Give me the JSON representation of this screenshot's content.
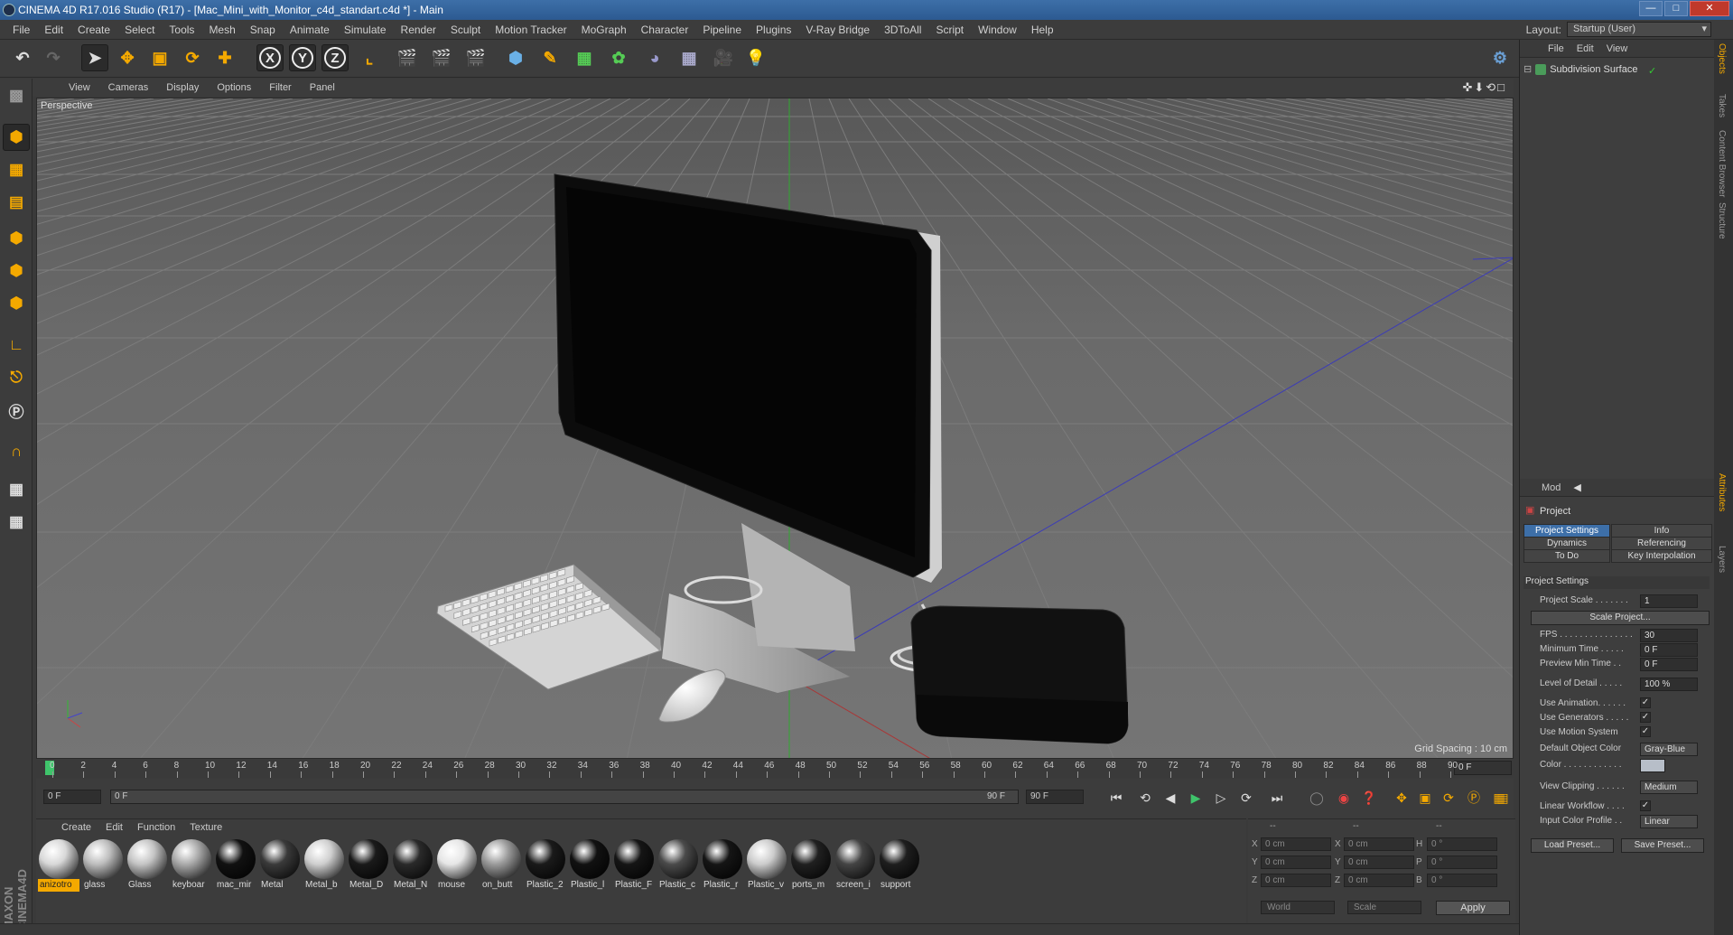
{
  "window": {
    "title": "CINEMA 4D R17.016 Studio (R17) - [Mac_Mini_with_Monitor_c4d_standart.c4d *] - Main",
    "min": "—",
    "max": "□",
    "close": "✕"
  },
  "menu": [
    "File",
    "Edit",
    "Create",
    "Select",
    "Tools",
    "Mesh",
    "Snap",
    "Animate",
    "Simulate",
    "Render",
    "Sculpt",
    "Motion Tracker",
    "MoGraph",
    "Character",
    "Pipeline",
    "Plugins",
    "V-Ray Bridge",
    "3DToAll",
    "Script",
    "Window",
    "Help"
  ],
  "layout": {
    "label": "Layout:",
    "value": "Startup (User)"
  },
  "toolbar": {
    "axis_x": "X",
    "axis_y": "Y",
    "axis_z": "Z"
  },
  "viewport": {
    "menu": [
      "View",
      "Cameras",
      "Display",
      "Options",
      "Filter",
      "Panel"
    ],
    "label": "Perspective",
    "grid_spacing": "Grid Spacing : 10 cm",
    "nav_icons": "✜⬇⟲□"
  },
  "timeline": {
    "ticks": [
      "0",
      "2",
      "4",
      "6",
      "8",
      "10",
      "12",
      "14",
      "16",
      "18",
      "20",
      "22",
      "24",
      "26",
      "28",
      "30",
      "32",
      "34",
      "36",
      "38",
      "40",
      "42",
      "44",
      "46",
      "48",
      "50",
      "52",
      "54",
      "56",
      "58",
      "60",
      "62",
      "64",
      "66",
      "68",
      "70",
      "72",
      "74",
      "76",
      "78",
      "80",
      "82",
      "84",
      "86",
      "88",
      "90"
    ],
    "current_frame": "0 F"
  },
  "transport": {
    "start": "0 F",
    "range_start": "0 F",
    "range_end": "90 F",
    "end": "90 F"
  },
  "materials": {
    "menu": [
      "Create",
      "Edit",
      "Function",
      "Texture"
    ],
    "items": [
      {
        "name": "anizotro",
        "color": "#d8d8d8",
        "selected": true
      },
      {
        "name": "glass",
        "color": "#bdbdbd"
      },
      {
        "name": "Glass",
        "color": "#c4c4c4"
      },
      {
        "name": "keyboar",
        "color": "#aaaaaa"
      },
      {
        "name": "mac_mir",
        "color": "#111111"
      },
      {
        "name": "Metal",
        "color": "#3a3a3a"
      },
      {
        "name": "Metal_b",
        "color": "#cfcfcf"
      },
      {
        "name": "Metal_D",
        "color": "#1a1a1a"
      },
      {
        "name": "Metal_N",
        "color": "#2a2a2a"
      },
      {
        "name": "mouse",
        "color": "#e6e6e6"
      },
      {
        "name": "on_butt",
        "color": "#9a9a9a"
      },
      {
        "name": "Plastic_2",
        "color": "#1a1a1a"
      },
      {
        "name": "Plastic_l",
        "color": "#111111"
      },
      {
        "name": "Plastic_F",
        "color": "#151515"
      },
      {
        "name": "Plastic_c",
        "color": "#4a4a4a"
      },
      {
        "name": "Plastic_r",
        "color": "#151515"
      },
      {
        "name": "Plastic_v",
        "color": "#cccccc"
      },
      {
        "name": "ports_m",
        "color": "#202020"
      },
      {
        "name": "screen_i",
        "color": "#444444"
      },
      {
        "name": "support",
        "color": "#1e1e1e"
      }
    ]
  },
  "coords": {
    "head": [
      "--",
      "--",
      "--"
    ],
    "rows": [
      {
        "a": "X",
        "av": "0 cm",
        "b": "X",
        "bv": "0 cm",
        "c": "H",
        "cv": "0 °"
      },
      {
        "a": "Y",
        "av": "0 cm",
        "b": "Y",
        "bv": "0 cm",
        "c": "P",
        "cv": "0 °"
      },
      {
        "a": "Z",
        "av": "0 cm",
        "b": "Z",
        "bv": "0 cm",
        "c": "B",
        "cv": "0 °"
      }
    ],
    "world": "World",
    "scale": "Scale",
    "apply": "Apply"
  },
  "objects": {
    "menu": [
      "File",
      "Edit",
      "View"
    ],
    "item": "Subdivision Surface"
  },
  "attributes": {
    "mode": "Mod",
    "title": "Project",
    "tabs": [
      "Project Settings",
      "Info",
      "Dynamics",
      "Referencing",
      "To Do",
      "Key Interpolation"
    ],
    "section": "Project Settings",
    "project_scale": {
      "label": "Project Scale . . . . . . .",
      "value": "1"
    },
    "scale_project": "Scale Project...",
    "fps": {
      "label": "FPS . . . . . . . . . . . . . . .",
      "value": "30"
    },
    "min_time": {
      "label": "Minimum Time . . . . .",
      "value": "0 F"
    },
    "preview_min": {
      "label": "Preview Min Time . .",
      "value": "0 F"
    },
    "lod": {
      "label": "Level of Detail . . . . .",
      "value": "100 %"
    },
    "use_anim": {
      "label": "Use Animation. . . . . .",
      "value": "✓"
    },
    "use_gen": {
      "label": "Use Generators . . . . .",
      "value": "✓"
    },
    "use_motion": {
      "label": "Use Motion System",
      "value": "✓"
    },
    "def_color": {
      "label": "Default Object Color",
      "value": "Gray-Blue"
    },
    "color": {
      "label": "Color . . . . . . . . . . . ."
    },
    "view_clip": {
      "label": "View Clipping . . . . . .",
      "value": "Medium"
    },
    "linear_wf": {
      "label": "Linear Workflow . . . .",
      "value": "✓"
    },
    "input_profile": {
      "label": "Input Color Profile . .",
      "value": "Linear"
    },
    "load_preset": "Load Preset...",
    "save_preset": "Save Preset..."
  },
  "side_tabs": [
    "Objects",
    "Takes",
    "Content Browser",
    "Structure",
    "Attributes",
    "Layers"
  ]
}
